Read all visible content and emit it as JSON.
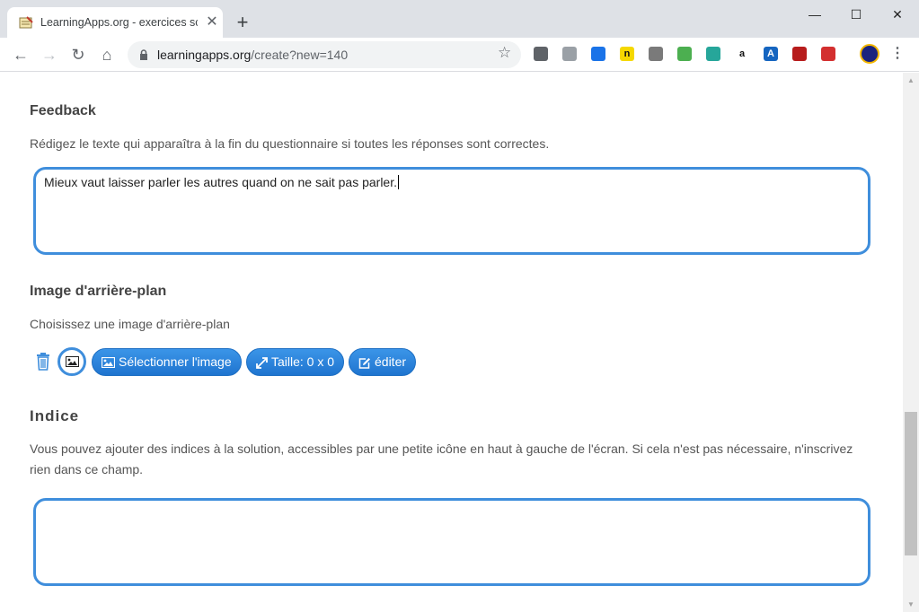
{
  "browser": {
    "tab_title": "LearningApps.org - exercices sco",
    "tab_close": "✕",
    "new_tab": "+",
    "window": {
      "minimize": "—",
      "maximize": "☐",
      "close": "✕"
    },
    "nav": {
      "back": "←",
      "forward": "→",
      "reload": "↻",
      "home": "⌂"
    },
    "url_host": "learningapps.org",
    "url_path": "/create?new=140",
    "star": "☆",
    "menu": "⋮"
  },
  "feedback": {
    "heading": "Feedback",
    "description": "Rédigez le texte qui apparaîtra à la fin du questionnaire si toutes les réponses sont correctes.",
    "value": "Mieux vaut laisser parler les autres quand on ne sait pas parler."
  },
  "background_image": {
    "heading": "Image d'arrière-plan",
    "description": "Choisissez une image d'arrière-plan",
    "select_label": "Sélectionner l'image",
    "size_label": "Taille: 0 x 0",
    "edit_label": "éditer"
  },
  "hint": {
    "heading": "Indice",
    "description_line1": "Vous pouvez ajouter des indices à la solution, accessibles par une petite icône en haut à gauche de l'écran. Si cela n'est pas nécessaire, n'inscrivez",
    "description_line2": "rien dans ce champ.",
    "value": ""
  },
  "extensions": [
    {
      "name": "ext-bulb-icon",
      "glyph": "",
      "color": "#5f6368"
    },
    {
      "name": "ext-screen-icon",
      "glyph": "",
      "color": "#9aa0a6"
    },
    {
      "name": "ext-bookmark-icon",
      "glyph": "",
      "color": "#1a73e8"
    },
    {
      "name": "ext-n-icon",
      "glyph": "n",
      "color": "#111111"
    },
    {
      "name": "ext-gear-icon",
      "glyph": "",
      "color": "#7a7a7a"
    },
    {
      "name": "ext-note-icon",
      "glyph": "",
      "color": "#4caf50"
    },
    {
      "name": "ext-hex-icon",
      "glyph": "",
      "color": "#26a69a"
    },
    {
      "name": "ext-amazon-icon",
      "glyph": "a",
      "color": "#ffffff"
    },
    {
      "name": "ext-translate-icon",
      "glyph": "A",
      "color": "#1565c0"
    },
    {
      "name": "ext-pdf-icon",
      "glyph": "",
      "color": "#b71c1c"
    },
    {
      "name": "ext-trend-icon",
      "glyph": "",
      "color": "#d32f2f"
    }
  ]
}
